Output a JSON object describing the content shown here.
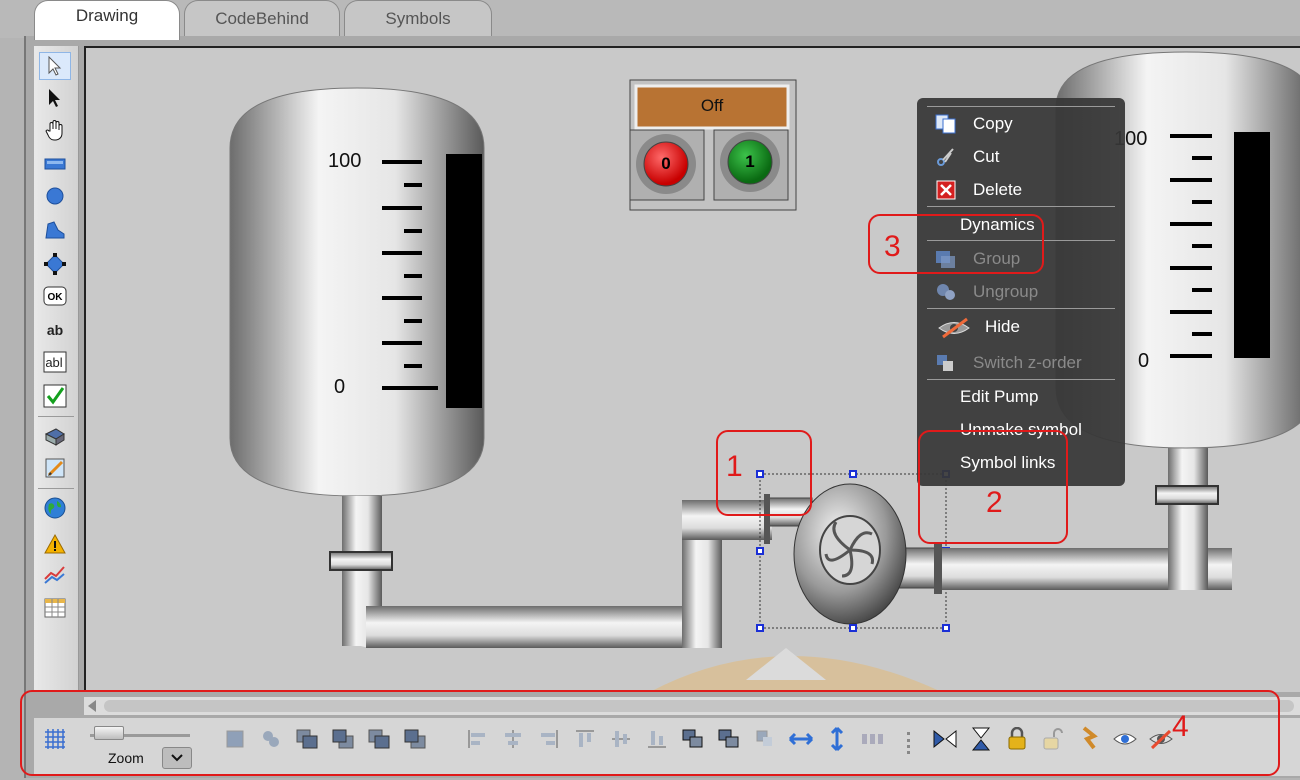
{
  "tabs": [
    {
      "label": "Drawing",
      "active": true
    },
    {
      "label": "CodeBehind",
      "active": false
    },
    {
      "label": "Symbols",
      "active": false
    }
  ],
  "toolbox": {
    "items": [
      "pointer-icon",
      "direct-select-icon",
      "pan-hand-icon",
      "rectangle-icon",
      "ellipse-icon",
      "polygon-icon",
      "node-edit-icon",
      "button-icon",
      "text-icon",
      "textbox-icon",
      "checkbox-icon",
      "3d-shape-icon",
      "image-icon",
      "web-browser-icon",
      "alarm-icon",
      "trend-icon",
      "table-icon"
    ]
  },
  "tank_left": {
    "scale_top": "100",
    "scale_bottom": "0"
  },
  "tank_right": {
    "scale_top": "100",
    "scale_bottom": "0"
  },
  "control_panel": {
    "status_label": "Off",
    "off_button": "0",
    "on_button": "1"
  },
  "context_menu": {
    "items": [
      {
        "label": "Copy",
        "icon": "copy-icon",
        "enabled": true
      },
      {
        "label": "Cut",
        "icon": "scissors-icon",
        "enabled": true
      },
      {
        "label": "Delete",
        "icon": "delete-icon",
        "enabled": true
      },
      {
        "label": "Dynamics",
        "enabled": true
      },
      {
        "label": "Group",
        "icon": "group-icon",
        "enabled": false
      },
      {
        "label": "Ungroup",
        "icon": "ungroup-icon",
        "enabled": false
      },
      {
        "label": "Hide",
        "icon": "hide-icon",
        "enabled": true
      },
      {
        "label": "Switch z-order",
        "icon": "z-order-icon",
        "enabled": false
      },
      {
        "label": "Edit Pump",
        "enabled": true
      },
      {
        "label": "Unmake symbol",
        "enabled": true
      },
      {
        "label": "Symbol links",
        "enabled": true
      }
    ]
  },
  "annotations": [
    "1",
    "2",
    "3",
    "4"
  ],
  "bottom_toolbar": {
    "zoom_label": "Zoom",
    "icons": [
      "grid-icon",
      "group-icon",
      "ungroup-icon",
      "bring-front-icon",
      "send-back-icon",
      "bring-forward-icon",
      "send-backward-icon",
      "align-left-icon",
      "align-center-icon",
      "align-right-icon",
      "align-top-icon",
      "align-middle-icon",
      "align-bottom-icon",
      "same-width-icon",
      "same-height-icon",
      "same-size-icon",
      "space-horizontal-icon",
      "space-vertical-icon",
      "distribute-icon",
      "flip-horizontal-icon",
      "flip-vertical-icon",
      "lock-icon",
      "unlock-icon",
      "link-icon",
      "show-icon",
      "hide-icon"
    ]
  },
  "colors": {
    "annotation": "#e01a1a",
    "status_label_bg": "#b87333",
    "off_button": "#e01010",
    "on_button": "#0f8a1a"
  }
}
